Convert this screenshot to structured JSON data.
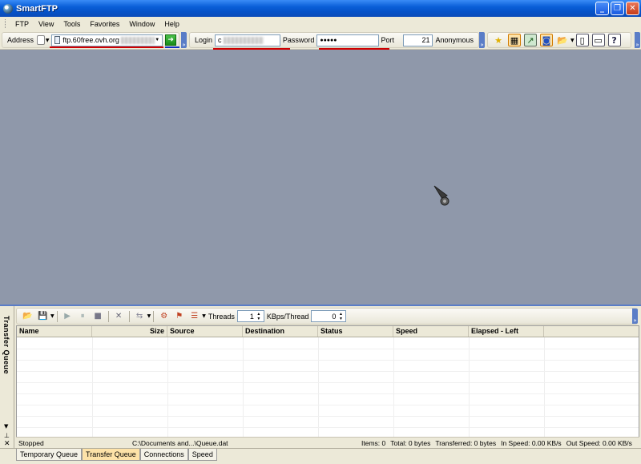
{
  "window": {
    "title": "SmartFTP",
    "controls": [
      "minimize",
      "restore",
      "close"
    ]
  },
  "menu": [
    "FTP",
    "View",
    "Tools",
    "Favorites",
    "Window",
    "Help"
  ],
  "toolbar": {
    "address_label": "Address",
    "address_value": "ftp.60free.ovh.org",
    "login_label": "Login",
    "login_value": "c",
    "password_label": "Password",
    "password_value": "●●●●●",
    "port_label": "Port",
    "port_value": "21",
    "anonymous_label": "Anonymous"
  },
  "queue": {
    "panel_title": "Transfer Queue",
    "threads_label": "Threads",
    "threads_value": "1",
    "kbps_label": "KBps/Thread",
    "kbps_value": "0",
    "columns": [
      "Name",
      "Size",
      "Source",
      "Destination",
      "Status",
      "Speed",
      "Elapsed - Left"
    ],
    "status": {
      "state": "Stopped",
      "file": "C:\\Documents and...\\Queue.dat",
      "items": "Items: 0",
      "total": "Total: 0 bytes",
      "transferred": "Transferred: 0 bytes",
      "in_speed": "In Speed: 0.00 KB/s",
      "out_speed": "Out Speed: 0.00 KB/s"
    }
  },
  "tabs": [
    "Temporary Queue",
    "Transfer Queue",
    "Connections",
    "Speed"
  ],
  "colors": {
    "titlebar": "#0a5fd8",
    "workspace": "#8f98aa",
    "active_tab": "#fde2a8",
    "highlight_underline": "#d00000"
  }
}
